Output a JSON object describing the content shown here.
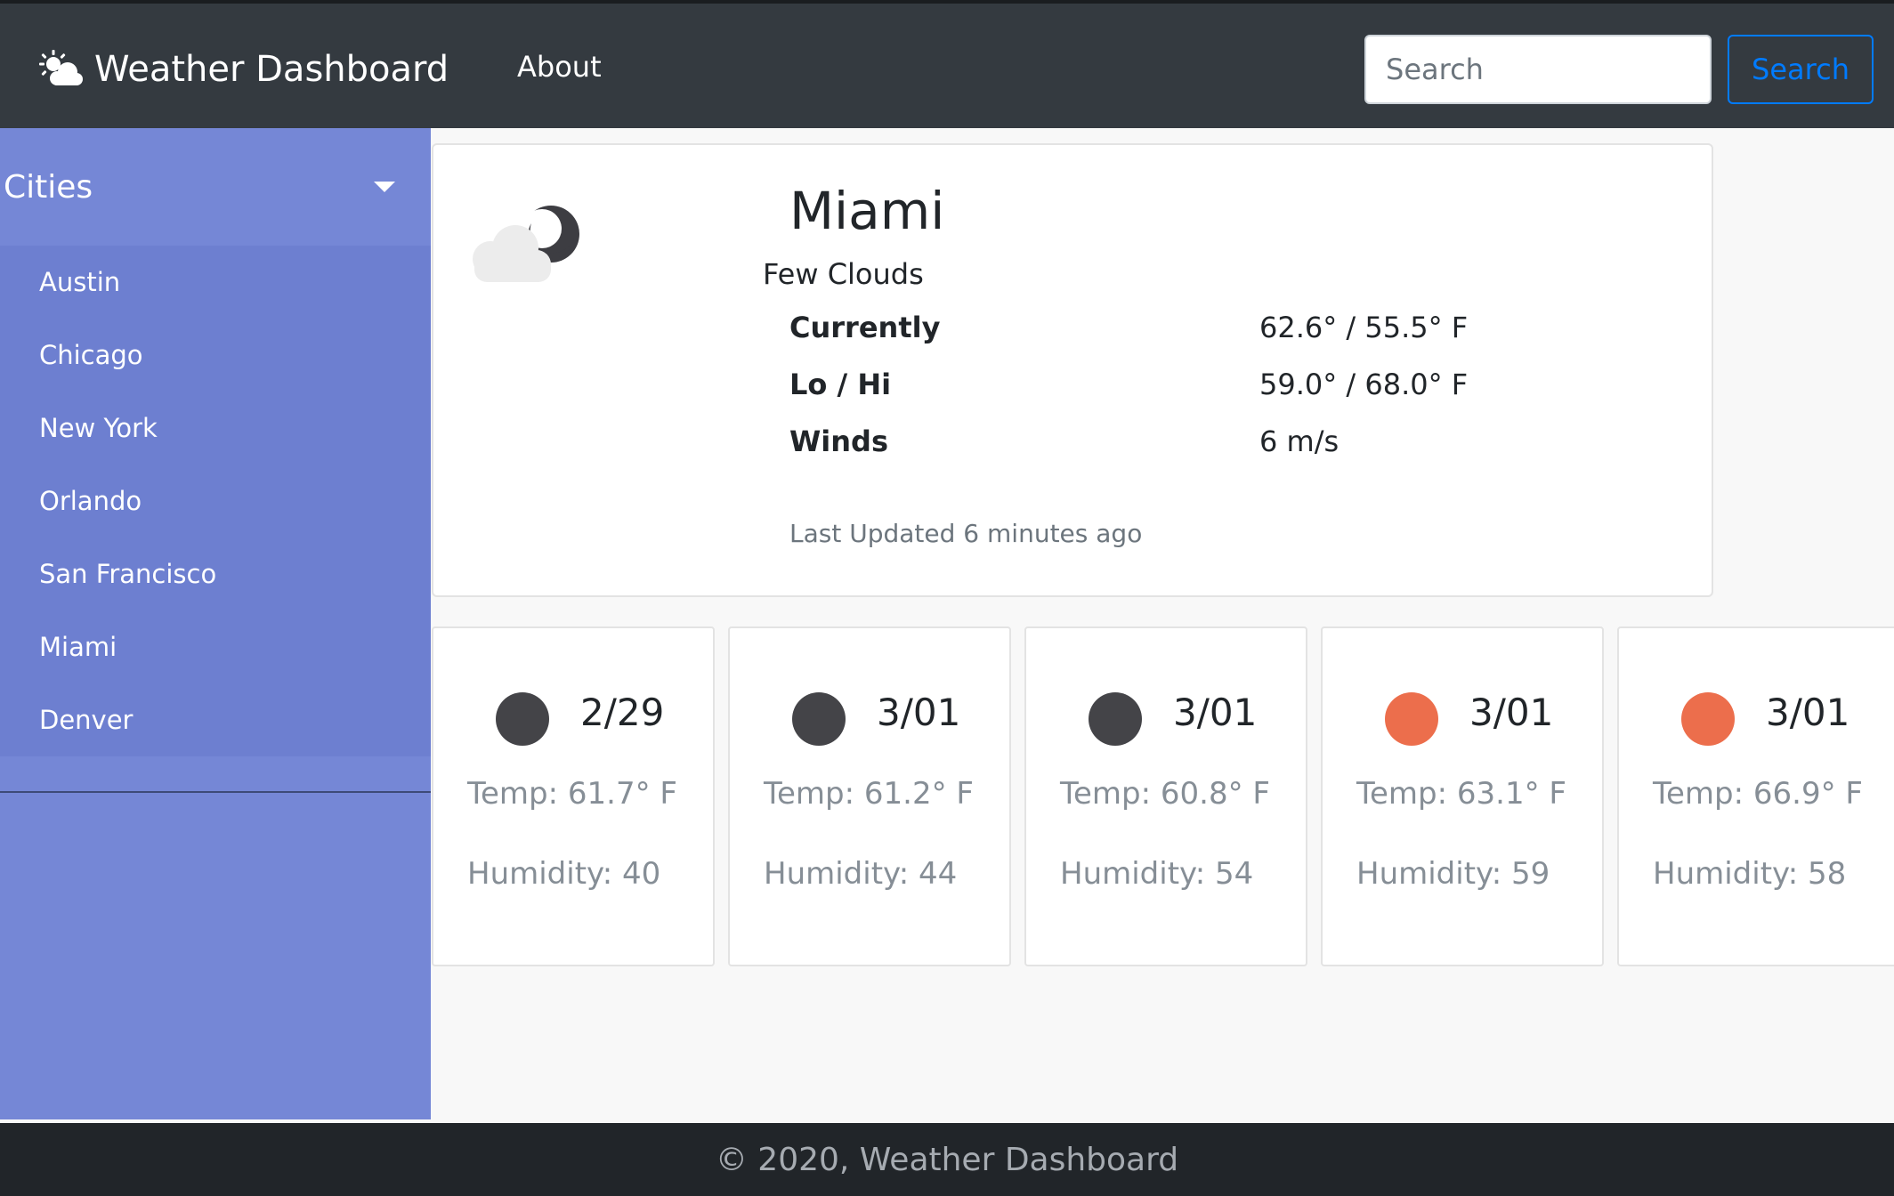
{
  "navbar": {
    "brand_icon": "sun-cloud-icon",
    "brand_title": "Weather Dashboard",
    "about_label": "About",
    "search_placeholder": "Search",
    "search_button_label": "Search",
    "colors": {
      "background": "#343a40",
      "accent": "#007bff"
    }
  },
  "sidebar": {
    "header_label": "Cities",
    "header_icon": "caret-down-icon",
    "cities": [
      "Austin",
      "Chicago",
      "New York",
      "Orlando",
      "San Francisco",
      "Miami",
      "Denver"
    ],
    "colors": {
      "background": "#7587d6",
      "list_background": "#6d7fd0"
    }
  },
  "current": {
    "icon": "cloud-moon-icon",
    "city": "Miami",
    "condition": "Few Clouds",
    "stats": [
      {
        "label": "Currently",
        "value": "62.6° / 55.5° F"
      },
      {
        "label": "Lo / Hi",
        "value": "59.0° / 68.0° F"
      },
      {
        "label": "Winds",
        "value": "6 m/s"
      }
    ],
    "last_updated": "Last Updated 6 minutes ago"
  },
  "forecast": [
    {
      "date": "2/29",
      "temp": "Temp: 61.7° F",
      "humidity": "Humidity: 40",
      "icon": "night-dot-icon",
      "color": "#444448"
    },
    {
      "date": "3/01",
      "temp": "Temp: 61.2° F",
      "humidity": "Humidity: 44",
      "icon": "night-dot-icon",
      "color": "#444448"
    },
    {
      "date": "3/01",
      "temp": "Temp: 60.8° F",
      "humidity": "Humidity: 54",
      "icon": "night-dot-icon",
      "color": "#444448"
    },
    {
      "date": "3/01",
      "temp": "Temp: 63.1° F",
      "humidity": "Humidity: 59",
      "icon": "sun-dot-icon",
      "color": "#ec6e4c"
    },
    {
      "date": "3/01",
      "temp": "Temp: 66.9° F",
      "humidity": "Humidity: 58",
      "icon": "sun-dot-icon",
      "color": "#ec6e4c"
    }
  ],
  "footer": {
    "text": "© 2020, Weather Dashboard"
  }
}
